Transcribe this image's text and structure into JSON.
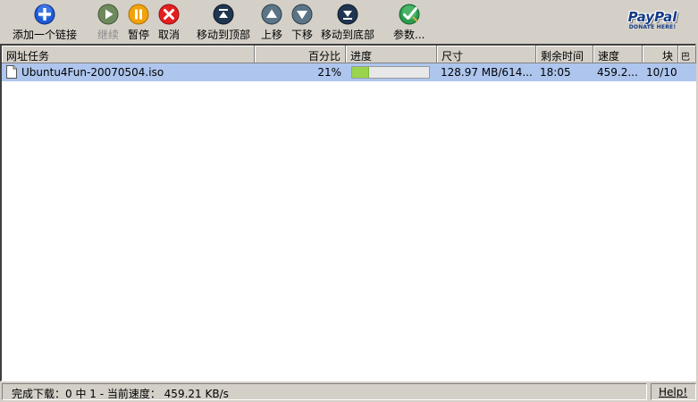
{
  "toolbar": {
    "add_link": "添加一个链接",
    "resume": "继续",
    "pause": "暂停",
    "cancel": "取消",
    "move_top": "移动到顶部",
    "move_up": "上移",
    "move_down": "下移",
    "move_bottom": "移动到底部",
    "options": "参数..."
  },
  "paypal": {
    "logo_text": "PayPal",
    "donate_text": "DONATE HERE!"
  },
  "columns": {
    "url_task": "网址任务",
    "percent": "百分比",
    "progress": "进度",
    "size": "尺寸",
    "time_left": "剩余时间",
    "speed": "速度",
    "chunks": "块",
    "extra": "巴"
  },
  "downloads": [
    {
      "name": "Ubuntu4Fun-20070504.iso",
      "percent": "21%",
      "progress_fraction": 0.21,
      "size": "128.97 MB/614...",
      "time_left": "18:05",
      "speed": "459.2...",
      "chunks": "10/10"
    }
  ],
  "status": {
    "text": "完成下载：0 中 1 - 当前速度： 459.21 KB/s",
    "help": "Help!"
  },
  "colors": {
    "selection": "#aec6ee",
    "progress_fill": "#9ad34c"
  }
}
